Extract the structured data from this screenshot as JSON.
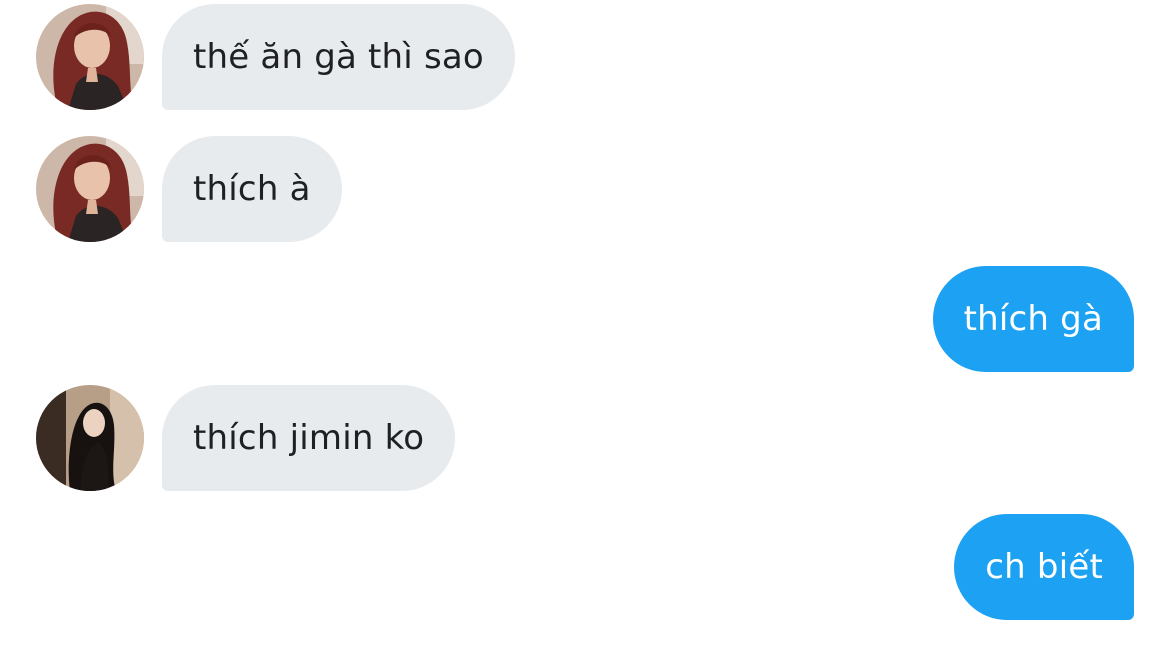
{
  "conversation": {
    "messages": [
      {
        "direction": "incoming",
        "text": "thế ăn gà thì sao",
        "avatar": "avatar-red-hair"
      },
      {
        "direction": "incoming",
        "text": "thích à",
        "avatar": "avatar-red-hair"
      },
      {
        "direction": "outgoing",
        "text": "thích gà"
      },
      {
        "direction": "incoming",
        "text": "thích jimin ko",
        "avatar": "avatar-dark-hair"
      },
      {
        "direction": "outgoing",
        "text": "ch biết"
      }
    ]
  },
  "colors": {
    "incoming_bubble": "#e7ebee",
    "incoming_text": "#1e2024",
    "outgoing_bubble": "#1da1f2",
    "outgoing_text": "#ffffff",
    "background": "#ffffff"
  }
}
